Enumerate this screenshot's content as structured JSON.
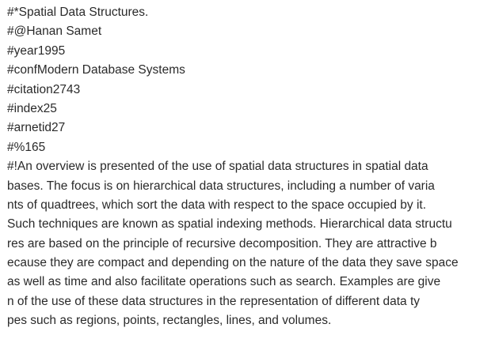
{
  "record": {
    "title_line": "#*Spatial Data Structures.",
    "author_line": "#@Hanan Samet",
    "year_line": "#year1995",
    "conf_line": "#confModern Database Systems",
    "citation_line": "#citation2743",
    "index_line": "#index25",
    "arnetid_line": "#arnetid27",
    "reference_line": "#%165",
    "abstract_lines": [
      "#!An overview is presented of the use of spatial data structures in spatial data",
      "bases. The focus is on hierarchical data structures, including a number of varia",
      "nts of quadtrees, which sort the data with respect to the space occupied by it.",
      "Such techniques are known as spatial indexing methods. Hierarchical data structu",
      "res are based on the principle of recursive decomposition. They are attractive b",
      "ecause they are compact and depending on the nature of the data they save space",
      "as well as time and also facilitate operations such as search. Examples are give",
      "n of the use of these data structures in the representation of different data ty",
      "pes such as regions, points, rectangles, lines, and volumes."
    ]
  }
}
